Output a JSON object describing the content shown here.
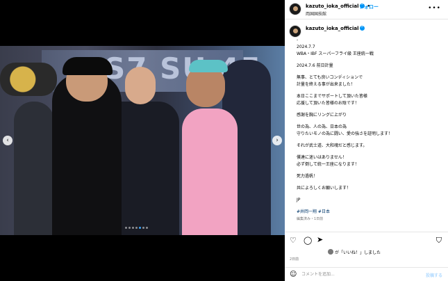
{
  "colors": {
    "accent": "#0095f6",
    "text": "#000000",
    "muted": "#737373",
    "link": "#00376b",
    "post_disabled": "#b3dbff"
  },
  "media": {
    "sign_text": "S7 SU  45",
    "carousel": {
      "count": 7,
      "active_index": 4
    },
    "prev_icon": "chevron-left-icon",
    "next_icon": "chevron-right-icon"
  },
  "header": {
    "username": "kazuto_ioka_official",
    "separator": "•",
    "follow_label": "フォロー",
    "subtitle": "両国国技館",
    "more_icon": "more-icon"
  },
  "caption": {
    "username": "kazuto_ioka_official",
    "lines": [
      "-",
      "2024.7.7",
      "WBA・IBF スーパーフライ級 王座統一戦",
      "",
      "2024.7.6 前日計量",
      "",
      "無事、とても良いコンディションで",
      "計量を終える事が出来ました！",
      "",
      "本日ここまでサポートして頂いた皆様",
      "応援して頂いた皆様のお陰です！",
      "",
      "感謝を胸にリングに上がり",
      "",
      "世の為、人の為、日本の為",
      "守りたいモノの為に闘い、愛の強さを証明します！",
      "",
      "それが武士道、大和魂だと感じます。",
      "",
      "僕達に迷いはありません！",
      "必ず倒して統一王座になります！",
      "",
      "死力過帆！",
      "",
      "共によろしくお願いします！",
      "",
      "JP",
      "",
      "#井岡一翔 #日本"
    ],
    "meta": "編集済み・1日前"
  },
  "actions": {
    "heart_icon": "heart-icon",
    "comment_icon": "comment-icon",
    "share_icon": "share-icon",
    "save_icon": "bookmark-icon",
    "likes_text": "が「いいね！」しました",
    "date": "2日前",
    "comment_placeholder": "コメントを追加...",
    "post_label": "投稿する",
    "emoji_icon": "emoji-icon"
  }
}
